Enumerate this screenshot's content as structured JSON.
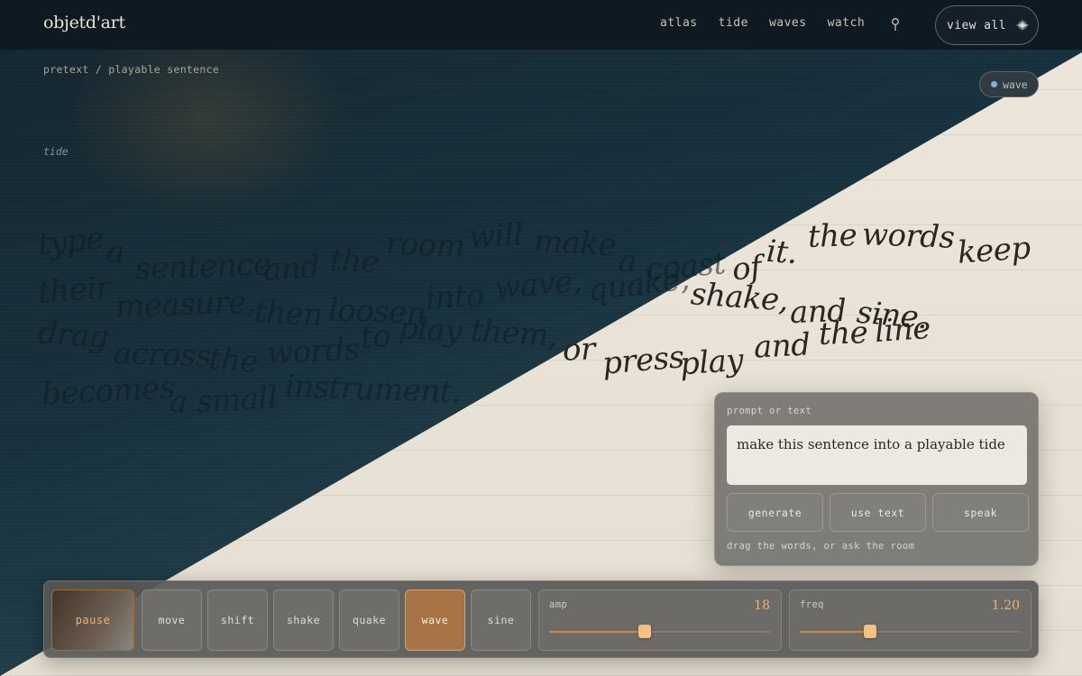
{
  "header": {
    "logo": "objetd'art",
    "nav": [
      "atlas",
      "tide",
      "waves",
      "watch"
    ],
    "view_all": "view all"
  },
  "breadcrumb": "pretext / playable sentence",
  "section_label": "tide",
  "mode_chip": "wave",
  "sentence": {
    "words": [
      "type",
      "a",
      "sentence",
      "and",
      "the",
      "room",
      "will",
      "make",
      "a",
      "coast",
      "of",
      "it.",
      "the",
      "words",
      "keep",
      "their",
      "measure,",
      "then",
      "loosen",
      "into",
      "wave,",
      "quake,",
      "shake,",
      "and",
      "sine.",
      "drag",
      "across",
      "the",
      "words",
      "to",
      "play",
      "them,",
      "or",
      "press",
      "play",
      "and",
      "the",
      "line",
      "becomes",
      "a",
      "small",
      "instrument."
    ]
  },
  "prompt": {
    "label": "prompt or text",
    "value": "make this sentence into a playable tide",
    "actions": [
      "generate",
      "use text",
      "speak"
    ],
    "hint": "drag the words, or ask the room"
  },
  "controls": {
    "pause": "pause",
    "modes": [
      "move",
      "shift",
      "shake",
      "quake",
      "wave",
      "sine"
    ],
    "active_mode": "wave",
    "amp": {
      "label": "amp",
      "value": "18",
      "fraction": 0.43
    },
    "freq": {
      "label": "freq",
      "value": "1.20",
      "fraction": 0.32
    }
  },
  "colors": {
    "accent": "#a87345",
    "accent_text": "#f0b070",
    "dark_bg": "#1a3340",
    "light_bg": "#ebe5da"
  }
}
